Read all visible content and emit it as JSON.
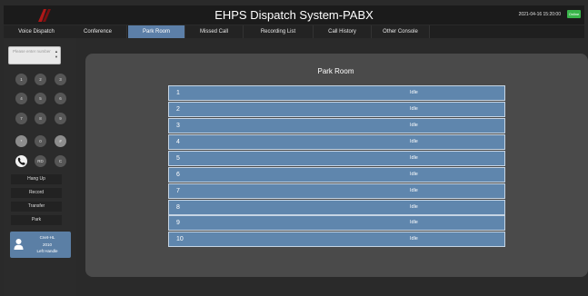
{
  "header": {
    "title": "EHPS Dispatch System-PABX",
    "datetime": "2021-04-16 15:20:00",
    "status": "Online",
    "colors": {
      "topbar": "#1b1b1b",
      "accent": "#5c7fa8",
      "status": "#39b54a"
    }
  },
  "tabs": [
    {
      "label": "Voice Dispatch",
      "active": false
    },
    {
      "label": "Conference",
      "active": false
    },
    {
      "label": "Park Room",
      "active": true
    },
    {
      "label": "Missed Call",
      "active": false
    },
    {
      "label": "Recording List",
      "active": false
    },
    {
      "label": "Call History",
      "active": false
    },
    {
      "label": "Other Console",
      "active": false
    }
  ],
  "dialer": {
    "placeholder": "Please enter number",
    "keys": [
      "1",
      "2",
      "3",
      "4",
      "5",
      "6",
      "7",
      "8",
      "9",
      "*",
      "0",
      "#"
    ],
    "bottom_keys": {
      "call_icon": "phone-icon",
      "redial": "RD",
      "clear": "C"
    },
    "actions": [
      "Hang Up",
      "Record",
      "Transfer",
      "Park"
    ]
  },
  "extension": {
    "name": "Cnet-HL",
    "number": "2010",
    "mode": "Left Handle",
    "icon": "person-icon"
  },
  "park_room": {
    "title": "Park Room",
    "slots": [
      {
        "id": "1",
        "status": "Idle"
      },
      {
        "id": "2",
        "status": "Idle"
      },
      {
        "id": "3",
        "status": "Idle"
      },
      {
        "id": "4",
        "status": "Idle"
      },
      {
        "id": "5",
        "status": "Idle"
      },
      {
        "id": "6",
        "status": "Idle"
      },
      {
        "id": "7",
        "status": "Idle"
      },
      {
        "id": "8",
        "status": "Idle"
      },
      {
        "id": "9",
        "status": "Idle"
      },
      {
        "id": "10",
        "status": "Idle"
      }
    ]
  }
}
